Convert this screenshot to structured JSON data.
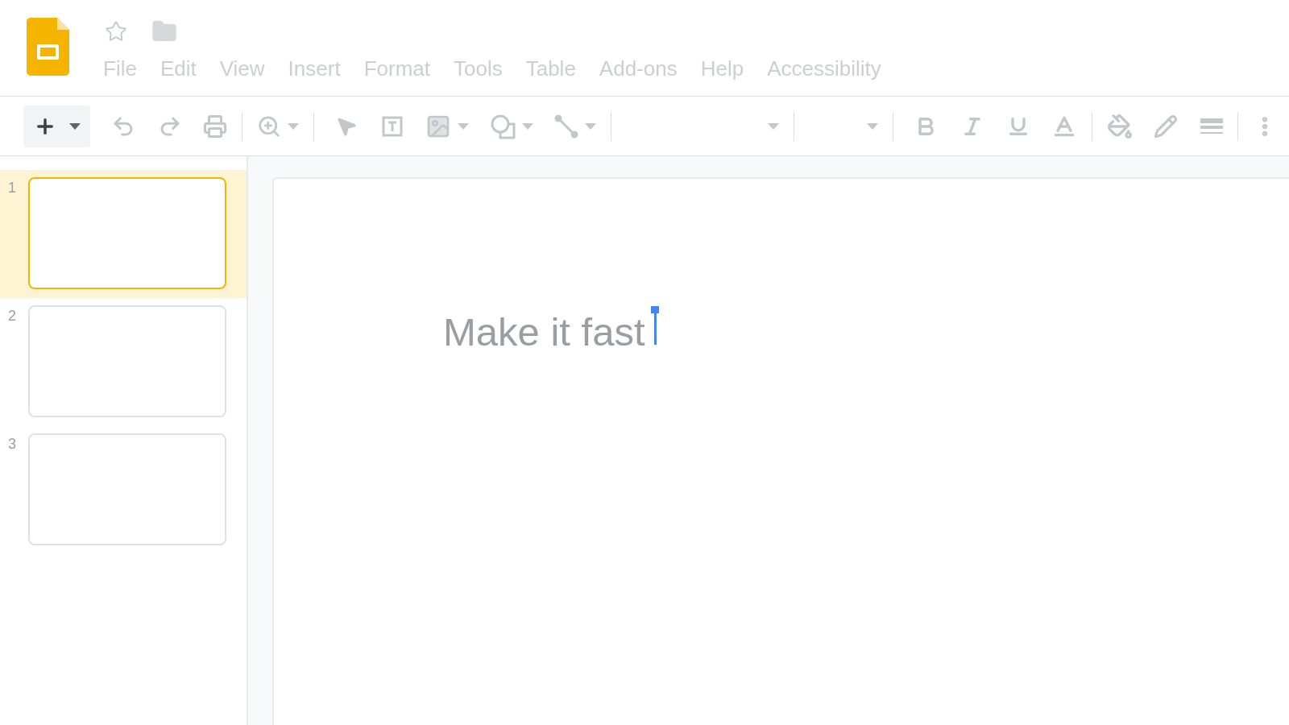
{
  "menu": [
    "File",
    "Edit",
    "View",
    "Insert",
    "Format",
    "Tools",
    "Table",
    "Add-ons",
    "Help",
    "Accessibility"
  ],
  "slides": [
    {
      "number": "1",
      "selected": true
    },
    {
      "number": "2",
      "selected": false
    },
    {
      "number": "3",
      "selected": false
    }
  ],
  "canvas": {
    "text": "Make it fast"
  }
}
